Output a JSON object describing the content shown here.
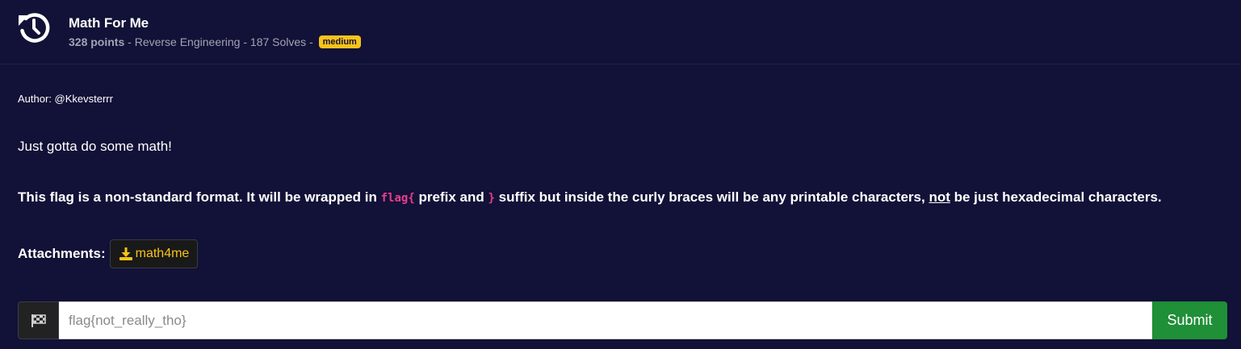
{
  "challenge": {
    "title": "Math For Me",
    "points": "328 points",
    "sep1": " - ",
    "category": "Reverse Engineering",
    "sep2": " - ",
    "solves": "187 Solves",
    "sep3": " - ",
    "difficulty": "medium",
    "icon": "history-icon"
  },
  "description": {
    "author": "Author: @Kkevsterrr",
    "text": "Just gotta do some math!",
    "note_part1": "This flag is a non-standard format. It will be wrapped in ",
    "note_code1": "flag{",
    "note_part2": " prefix and ",
    "note_code2": "}",
    "note_part3": " suffix but inside the curly braces will be any printable characters, ",
    "note_emph": "not",
    "note_part4": " be just hexadecimal characters."
  },
  "attachments": {
    "label": "Attachments:",
    "files": [
      {
        "name": "math4me",
        "icon": "download-icon"
      }
    ]
  },
  "flag_form": {
    "addon_icon": "checkered-flag-icon",
    "placeholder": "flag{not_really_tho}",
    "value": "",
    "submit_label": "Submit"
  },
  "colors": {
    "background": "#121137",
    "badge": "#f7c31a",
    "code": "#e83e8c",
    "attachment_text": "#f7c31a",
    "submit": "#1f8f38"
  }
}
